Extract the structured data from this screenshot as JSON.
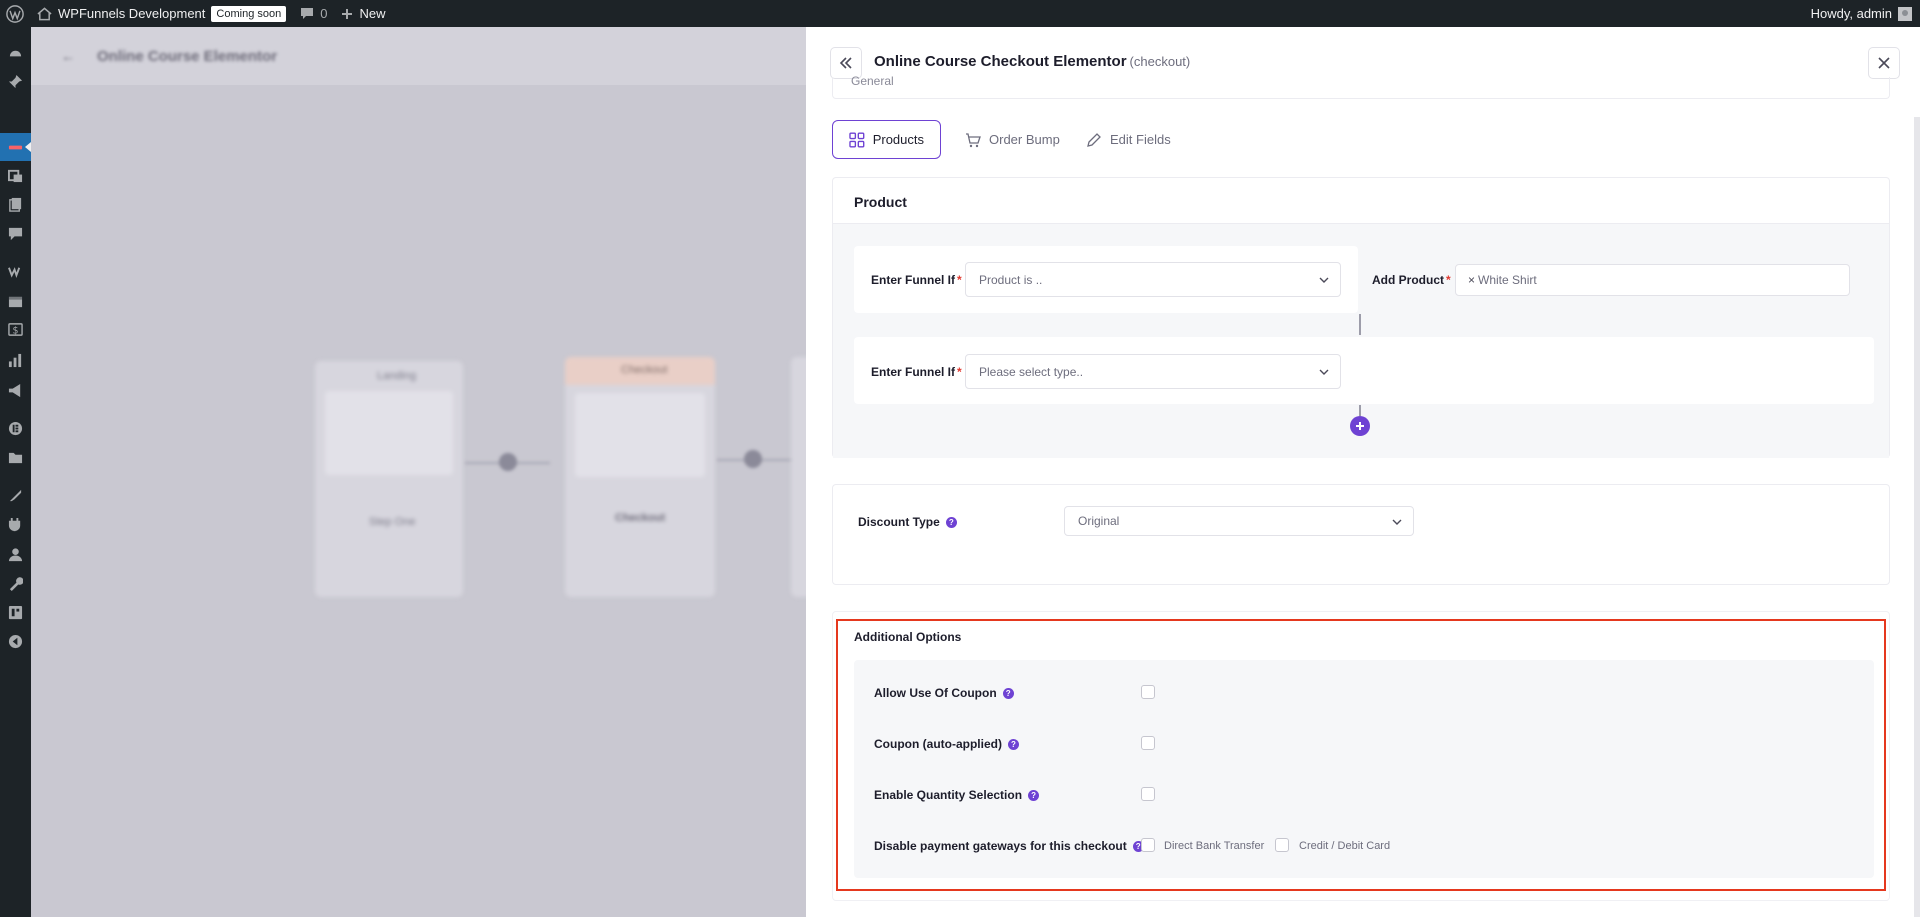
{
  "adminbar": {
    "site_name": "WPFunnels Development",
    "coming_soon": "Coming soon",
    "comments_count": "0",
    "new_label": "New",
    "howdy": "Howdy, admin"
  },
  "canvas": {
    "title": "Online Course Elementor",
    "nodes": [
      {
        "label": "Landing",
        "name": "Step One"
      },
      {
        "label": "Checkout",
        "name": "Checkout"
      }
    ]
  },
  "panel": {
    "title": "Online Course Checkout Elementor",
    "subtitle": "(checkout)",
    "general_label": "General",
    "tabs": [
      {
        "label": "Products",
        "icon": "grid-icon",
        "active": true
      },
      {
        "label": "Order Bump",
        "icon": "cart-icon",
        "active": false
      },
      {
        "label": "Edit Fields",
        "icon": "pencil-icon",
        "active": false
      }
    ],
    "product": {
      "heading": "Product",
      "conditions": [
        {
          "label": "Enter Funnel If",
          "required": "*",
          "select_value": "Product is ..",
          "add_label": "Add Product",
          "add_required": "*",
          "tag": "White Shirt"
        },
        {
          "label": "Enter Funnel If",
          "required": "*",
          "select_value": "Please select type.."
        }
      ]
    },
    "discount": {
      "label": "Discount Type",
      "value": "Original"
    },
    "additional": {
      "heading": "Additional Options",
      "options": [
        {
          "label": "Allow Use Of Coupon",
          "checked": false
        },
        {
          "label": "Coupon (auto-applied)",
          "checked": false
        },
        {
          "label": "Enable Quantity Selection",
          "checked": false
        },
        {
          "label": "Disable payment gateways for this checkout"
        }
      ],
      "gateways": [
        {
          "label": "Direct Bank Transfer",
          "checked": false
        },
        {
          "label": "Credit / Debit Card",
          "checked": false
        }
      ]
    },
    "colors": {
      "accent": "#6e42d3",
      "highlight": "#e5381e",
      "required": "#e0382f"
    }
  }
}
